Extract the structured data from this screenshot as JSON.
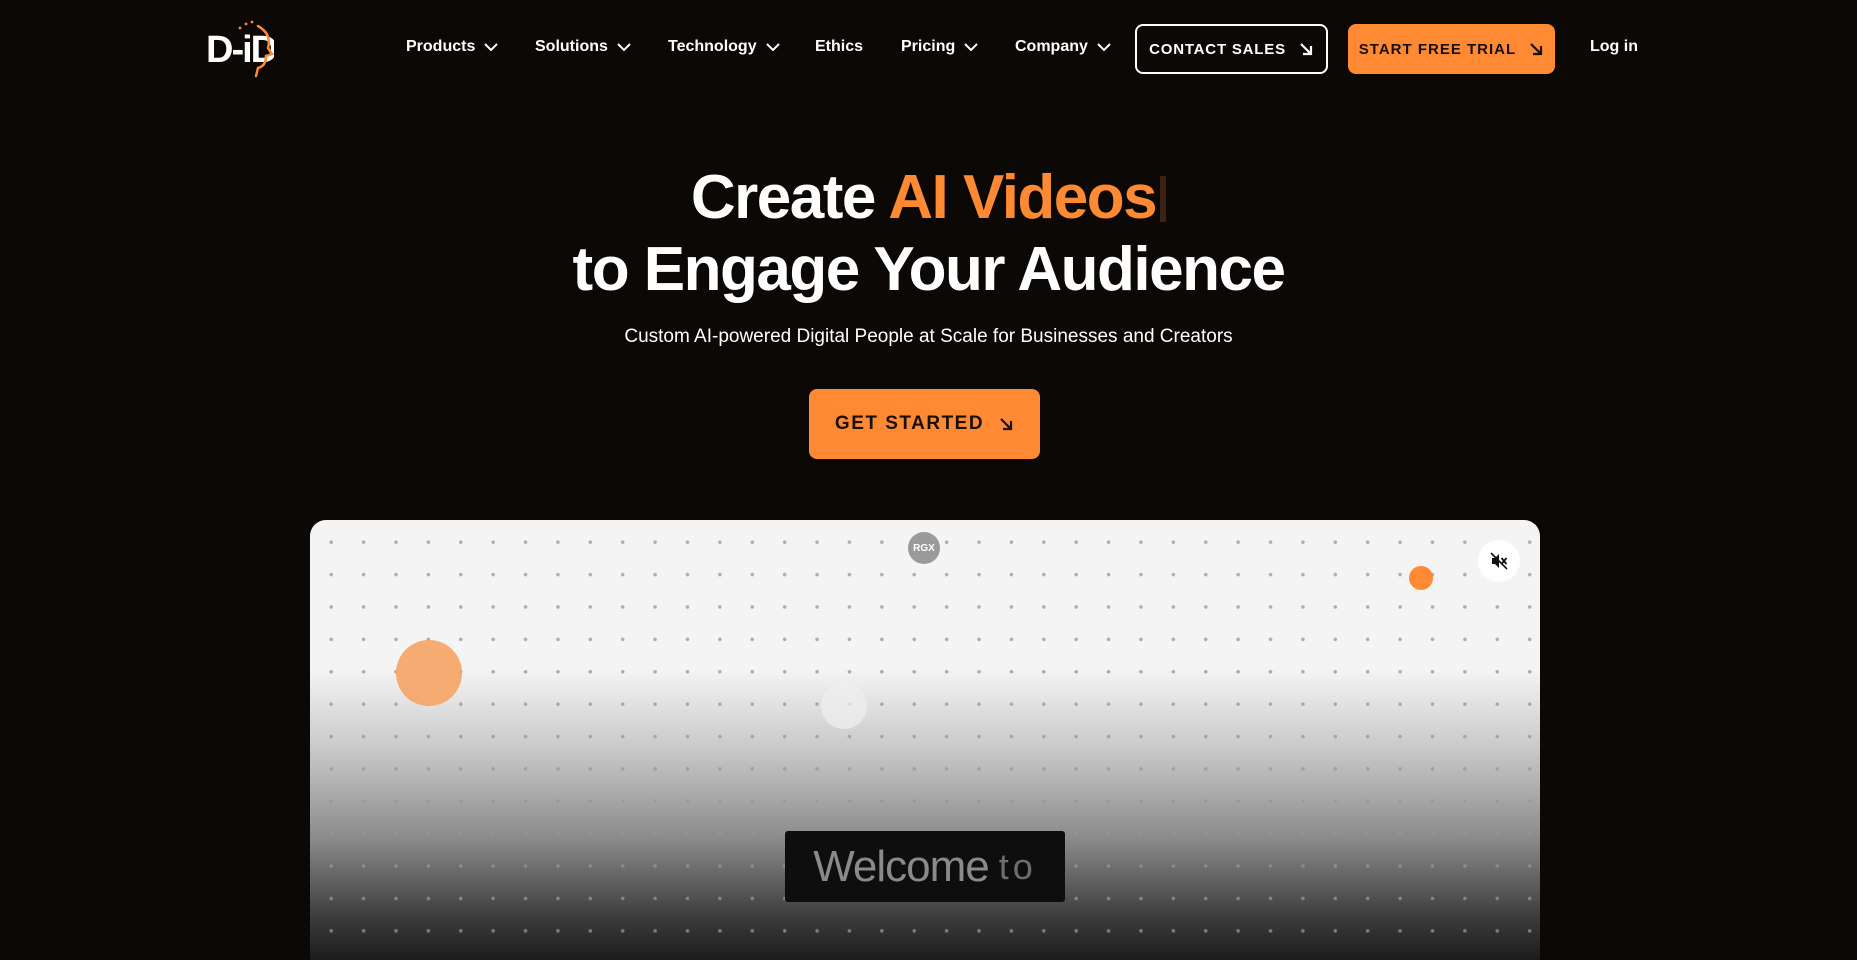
{
  "nav": {
    "logo_text": "D-ID",
    "items": [
      {
        "label": "Products",
        "has_dropdown": true
      },
      {
        "label": "Solutions",
        "has_dropdown": true
      },
      {
        "label": "Technology",
        "has_dropdown": true
      },
      {
        "label": "Ethics",
        "has_dropdown": false
      },
      {
        "label": "Pricing",
        "has_dropdown": true
      },
      {
        "label": "Company",
        "has_dropdown": true
      }
    ],
    "contact_sales": "CONTACT SALES",
    "start_trial": "START FREE TRIAL",
    "login": "Log in"
  },
  "hero": {
    "line1_prefix": "Create ",
    "line1_accent": "AI Videos",
    "line2": "to Engage Your Audience",
    "subtitle": "Custom AI-powered Digital People at Scale for Businesses and Creators",
    "cta": "GET STARTED"
  },
  "demo": {
    "badge": "RGX",
    "welcome_word": "Welcome",
    "welcome_suffix": "to"
  },
  "colors": {
    "background": "#0b0806",
    "accent": "#ff8a33",
    "text": "#ffffff"
  },
  "icons": {
    "chevron": "chevron-down-icon",
    "arrow": "arrow-down-right-icon",
    "mute": "speaker-muted-icon"
  }
}
